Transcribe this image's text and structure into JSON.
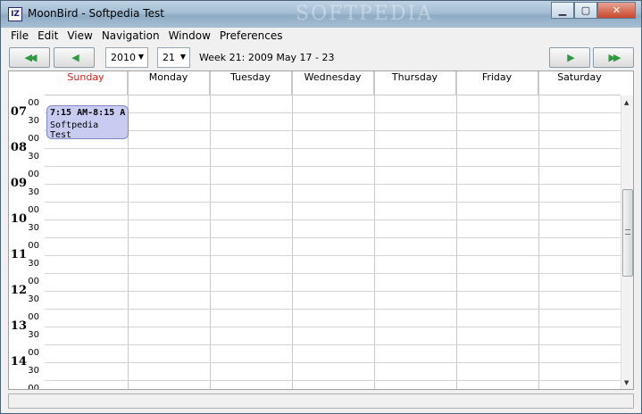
{
  "window": {
    "title": "MoonBird - Softpedia Test",
    "icon_text": "IZ",
    "watermark": "SOFTPEDIA"
  },
  "menu": [
    "File",
    "Edit",
    "View",
    "Navigation",
    "Window",
    "Preferences"
  ],
  "toolbar": {
    "year": "2010",
    "week": "21",
    "week_label": "Week 21: 2009 May 17 - 23"
  },
  "days": [
    "Sunday",
    "Monday",
    "Tuesday",
    "Wednesday",
    "Thursday",
    "Friday",
    "Saturday"
  ],
  "hours": [
    "07",
    "08",
    "09",
    "10",
    "11",
    "12",
    "13",
    "14"
  ],
  "minute_labels": [
    "00",
    "30"
  ],
  "event": {
    "time": "7:15 AM-8:15 A",
    "title": "Softpedia Test",
    "day": "Sunday"
  },
  "colors": {
    "sunday": "#e0201c",
    "event_bg": "#c8ccf0",
    "nav_arrow": "#2e9a3e"
  }
}
